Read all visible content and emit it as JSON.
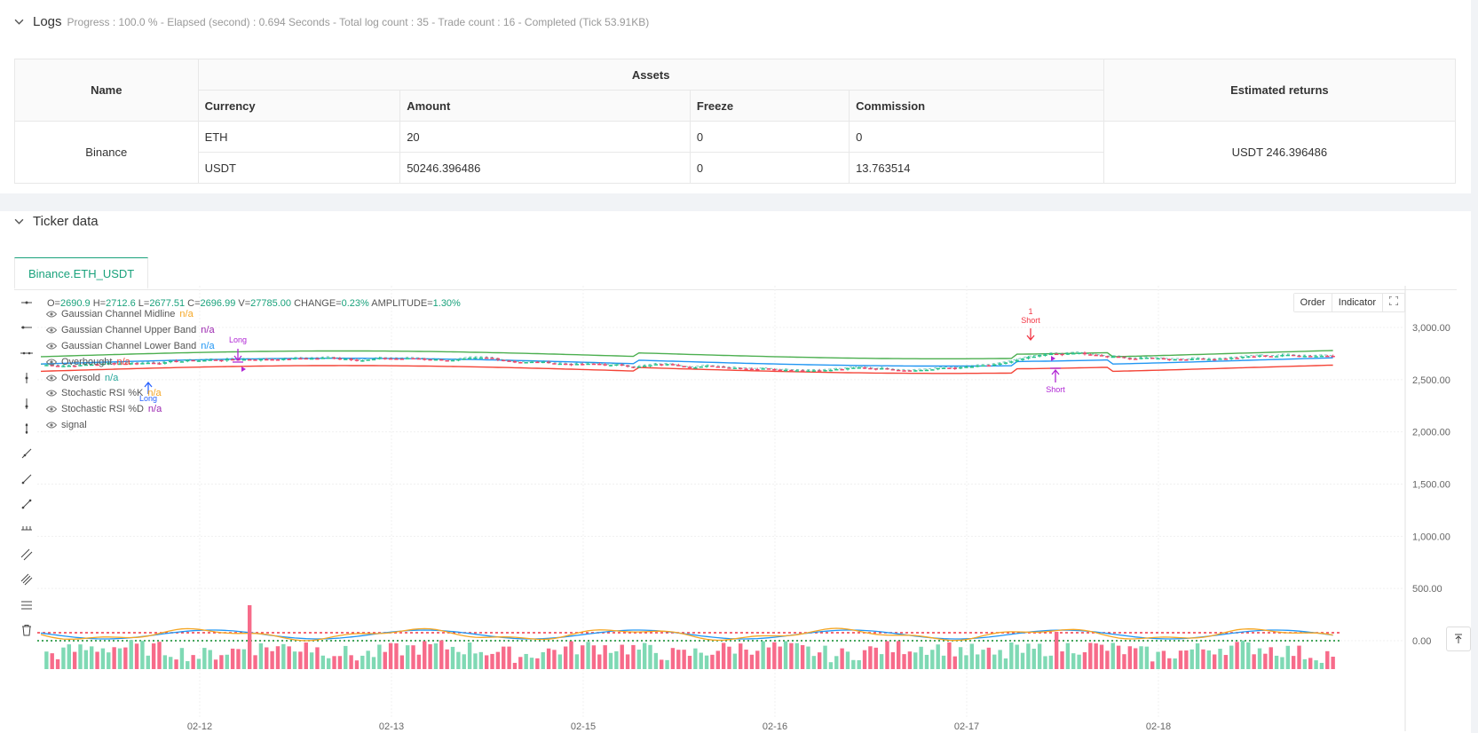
{
  "logs": {
    "title": "Logs",
    "progress": "Progress : 100.0 % - Elapsed (second) : 0.694 Seconds - Total log count : 35 - Trade count : 16 - Completed (Tick 53.91KB)"
  },
  "assets_table": {
    "col_name": "Name",
    "col_assets": "Assets",
    "col_returns": "Estimated returns",
    "sub_currency": "Currency",
    "sub_amount": "Amount",
    "sub_freeze": "Freeze",
    "sub_commission": "Commission",
    "exchange": "Binance",
    "rows": [
      {
        "currency": "ETH",
        "amount": "20",
        "freeze": "0",
        "commission": "0"
      },
      {
        "currency": "USDT",
        "amount": "50246.396486",
        "freeze": "0",
        "commission": "13.763514"
      }
    ],
    "estimated_returns": "USDT 246.396486"
  },
  "ticker": {
    "title": "Ticker data",
    "tab": "Binance.ETH_USDT",
    "ohlc": {
      "o_label": "O=",
      "o": "2690.9",
      "h_label": "H=",
      "h": "2712.6",
      "l_label": "L=",
      "l": "2677.51",
      "c_label": "C=",
      "c": "2696.99",
      "v_label": "V=",
      "v": "27785.00",
      "change_label": "CHANGE=",
      "change": "0.23%",
      "amp_label": "AMPLITUDE=",
      "amp": "1.30%"
    },
    "legend": [
      {
        "name": "Gaussian Channel Midline",
        "value": "n/a",
        "color": "#f5a623"
      },
      {
        "name": "Gaussian Channel Upper Band",
        "value": "n/a",
        "color": "#9c27b0"
      },
      {
        "name": "Gaussian Channel Lower Band",
        "value": "n/a",
        "color": "#2196f3"
      },
      {
        "name": "Overbought",
        "value": "n/a",
        "color": "#f44336"
      },
      {
        "name": "Oversold",
        "value": "n/a",
        "color": "#26a69a"
      },
      {
        "name": "Stochastic RSI %K",
        "value": "n/a",
        "color": "#f5a623"
      },
      {
        "name": "Stochastic RSI %D",
        "value": "n/a",
        "color": "#9c27b0"
      },
      {
        "name": "signal",
        "value": "",
        "color": "#555"
      }
    ],
    "controls": {
      "order": "Order",
      "indicator": "Indicator"
    },
    "markers": {
      "long_top": "Long",
      "long_bottom": "Long",
      "short_top_num": "1",
      "short_top": "Short",
      "short_bottom": "Short"
    }
  },
  "chart_data": {
    "type": "candlestick",
    "y_ticks": [
      "3,000.00",
      "2,500.00",
      "2,000.00",
      "1,500.00",
      "1,000.00",
      "500.00",
      "0.00"
    ],
    "x_ticks": [
      "02-12",
      "02-13",
      "02-15",
      "02-16",
      "02-17",
      "02-18"
    ],
    "price_range": [
      0,
      3300
    ],
    "channel": {
      "upper": 2760,
      "mid": 2690,
      "lower": 2620
    },
    "colors": {
      "up": "#26c28a",
      "down": "#f0446a",
      "upper": "#4caf50",
      "mid": "#2196f3",
      "lower": "#f44336"
    }
  }
}
